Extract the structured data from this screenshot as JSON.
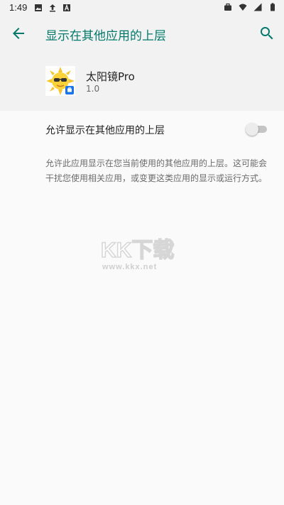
{
  "status_bar": {
    "time": "1:49",
    "left_icons": [
      "image-icon",
      "upload-icon",
      "a-icon"
    ],
    "right_icons": [
      "briefcase-icon",
      "wifi-icon",
      "signal-icon",
      "battery-icon"
    ]
  },
  "app_bar": {
    "title": "显示在其他应用的上层",
    "back_icon": "arrow-back-icon",
    "search_icon": "search-icon",
    "accent_color": "#00796b"
  },
  "app_info": {
    "name": "太阳镜Pro",
    "version": "1.0",
    "icon": "sun-with-sunglasses-icon",
    "badge": "work-profile-badge-icon"
  },
  "setting": {
    "label": "允许显示在其他应用的上层",
    "toggle_on": false
  },
  "description": "允许此应用显示在您当前使用的其他应用的上层。这可能会干扰您使用相关应用，或变更这类应用的显示或运行方式。",
  "watermark": {
    "text": "KK下载",
    "url": "www.kkx.net"
  }
}
